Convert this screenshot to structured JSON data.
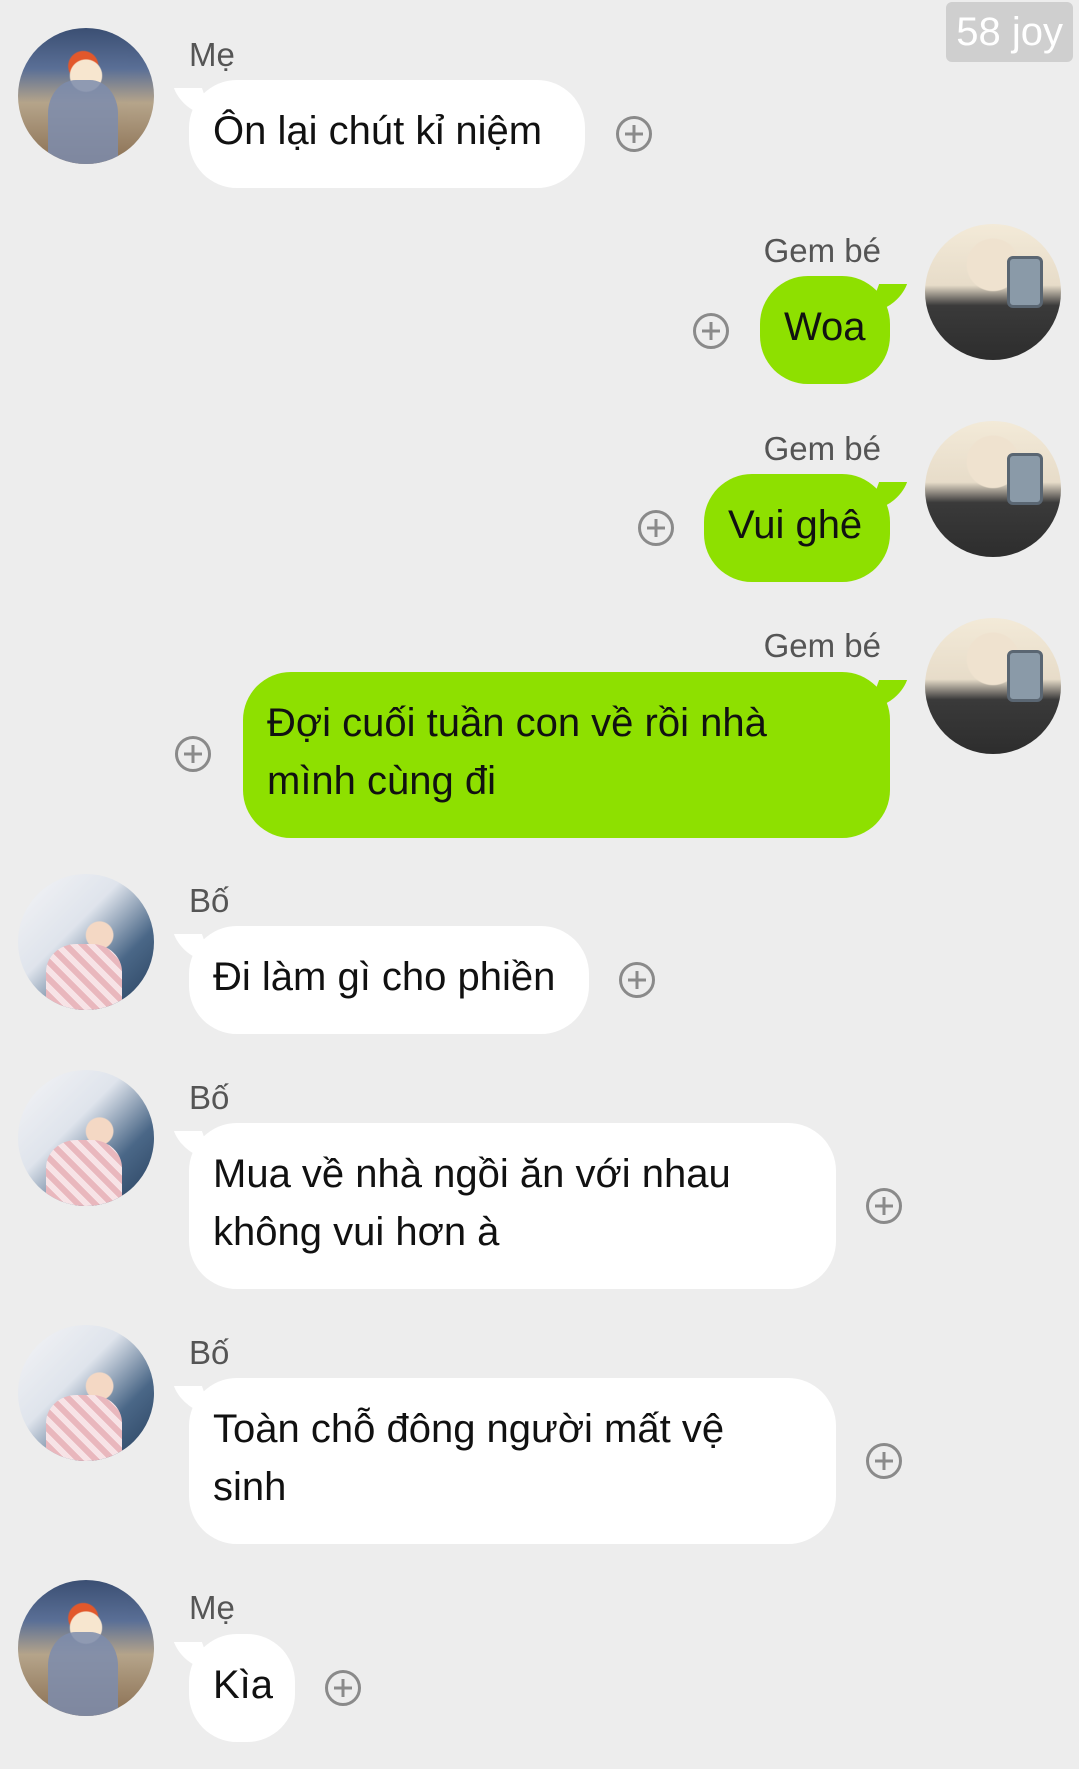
{
  "watermark": "58 joy",
  "messages": [
    {
      "sender": "Mẹ",
      "text": "Ôn lại chút kỉ niệm"
    },
    {
      "sender": "Gem bé",
      "text": "Woa"
    },
    {
      "sender": "Gem bé",
      "text": "Vui ghê"
    },
    {
      "sender": "Gem bé",
      "text": "Đợi cuối tuần con về rồi nhà mình cùng đi"
    },
    {
      "sender": "Bố",
      "text": "Đi làm gì cho phiền"
    },
    {
      "sender": "Bố",
      "text": "Mua về nhà ngồi ăn với nhau không vui hơn à"
    },
    {
      "sender": "Bố",
      "text": "Toàn chỗ đông người mất vệ sinh"
    },
    {
      "sender": "Mẹ",
      "text": "Kìa"
    }
  ],
  "icons": {
    "reaction": "add-reaction-icon",
    "avatar_me": "avatar-mother",
    "avatar_dad": "avatar-father",
    "avatar_gem": "avatar-gem"
  },
  "colors": {
    "background": "#ededed",
    "incoming_bubble": "#ffffff",
    "outgoing_bubble": "#8ee000"
  }
}
